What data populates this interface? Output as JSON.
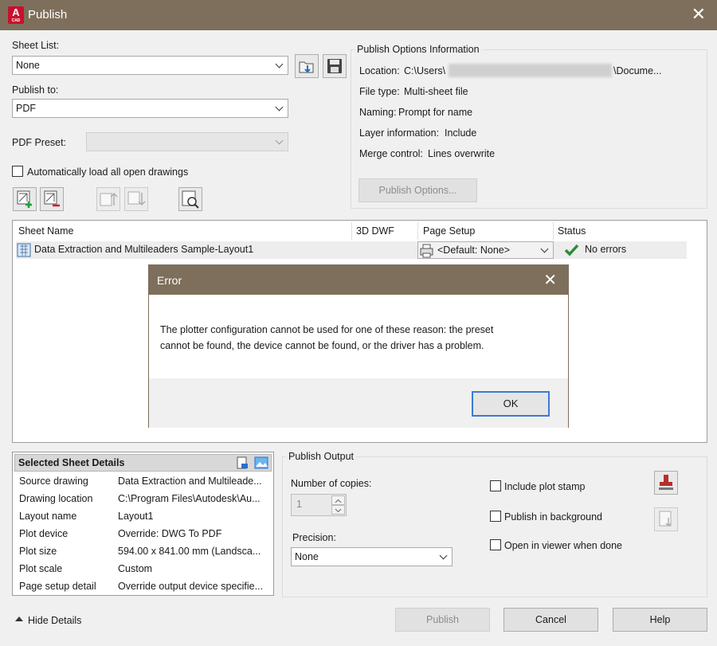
{
  "window": {
    "app_logo_letter": "A",
    "app_logo_sub": "CAD",
    "title": "Publish",
    "close_glyph": "✕"
  },
  "sheet_list": {
    "label": "Sheet List:",
    "value": "None"
  },
  "publish_to": {
    "label": "Publish to:",
    "value": "PDF"
  },
  "pdf_preset": {
    "label": "PDF Preset:",
    "value": ""
  },
  "auto_load": {
    "label": "Automatically load all open drawings",
    "checked": false
  },
  "options_info": {
    "title": "Publish Options Information",
    "location_label": "Location:",
    "location_value_start": "C:\\Users\\",
    "location_value_end": "\\Docume...",
    "filetype_label": "File type:",
    "filetype_value": "Multi-sheet file",
    "naming_label": "Naming:",
    "naming_value": "Prompt for name",
    "layer_label": "Layer information:",
    "layer_value": "Include",
    "merge_label": "Merge control:",
    "merge_value": "Lines overwrite",
    "button": "Publish Options..."
  },
  "sheet_table": {
    "columns": [
      "Sheet Name",
      "3D DWF",
      "Page Setup",
      "Status"
    ],
    "rows": [
      {
        "name": "Data Extraction and Multileaders Sample-Layout1",
        "dwf": "",
        "page_setup": "<Default: None>",
        "status": "No errors"
      }
    ]
  },
  "error_dialog": {
    "title": "Error",
    "close_glyph": "✕",
    "message_line1": "The plotter configuration cannot be used for one of these reason: the preset",
    "message_line2": "cannot be found, the device cannot be found, or the driver has a problem.",
    "ok_label": "OK"
  },
  "sheet_details": {
    "title": "Selected Sheet Details",
    "rows": [
      {
        "label": "Source drawing",
        "value": "Data Extraction and Multileade..."
      },
      {
        "label": "Drawing location",
        "value": "C:\\Program Files\\Autodesk\\Au..."
      },
      {
        "label": "Layout name",
        "value": "Layout1"
      },
      {
        "label": "Plot device",
        "value": "Override: DWG To PDF"
      },
      {
        "label": "Plot size",
        "value": "594.00 x 841.00 mm (Landsca..."
      },
      {
        "label": "Plot scale",
        "value": "Custom"
      },
      {
        "label": "Page setup detail",
        "value": "Override output device specifie..."
      }
    ]
  },
  "publish_output": {
    "title": "Publish Output",
    "copies_label": "Number of copies:",
    "copies_value": "1",
    "precision_label": "Precision:",
    "precision_value": "None",
    "plot_stamp_label": "Include plot stamp",
    "background_label": "Publish in background",
    "open_viewer_label": "Open in viewer when done"
  },
  "footer": {
    "hide_details": "Hide Details",
    "publish": "Publish",
    "cancel": "Cancel",
    "help": "Help"
  },
  "colors": {
    "titlebar": "#7d6f5b",
    "check_green": "#2e8b3a",
    "add_plus": "#1f9e3a",
    "remove_minus": "#d0202a"
  }
}
